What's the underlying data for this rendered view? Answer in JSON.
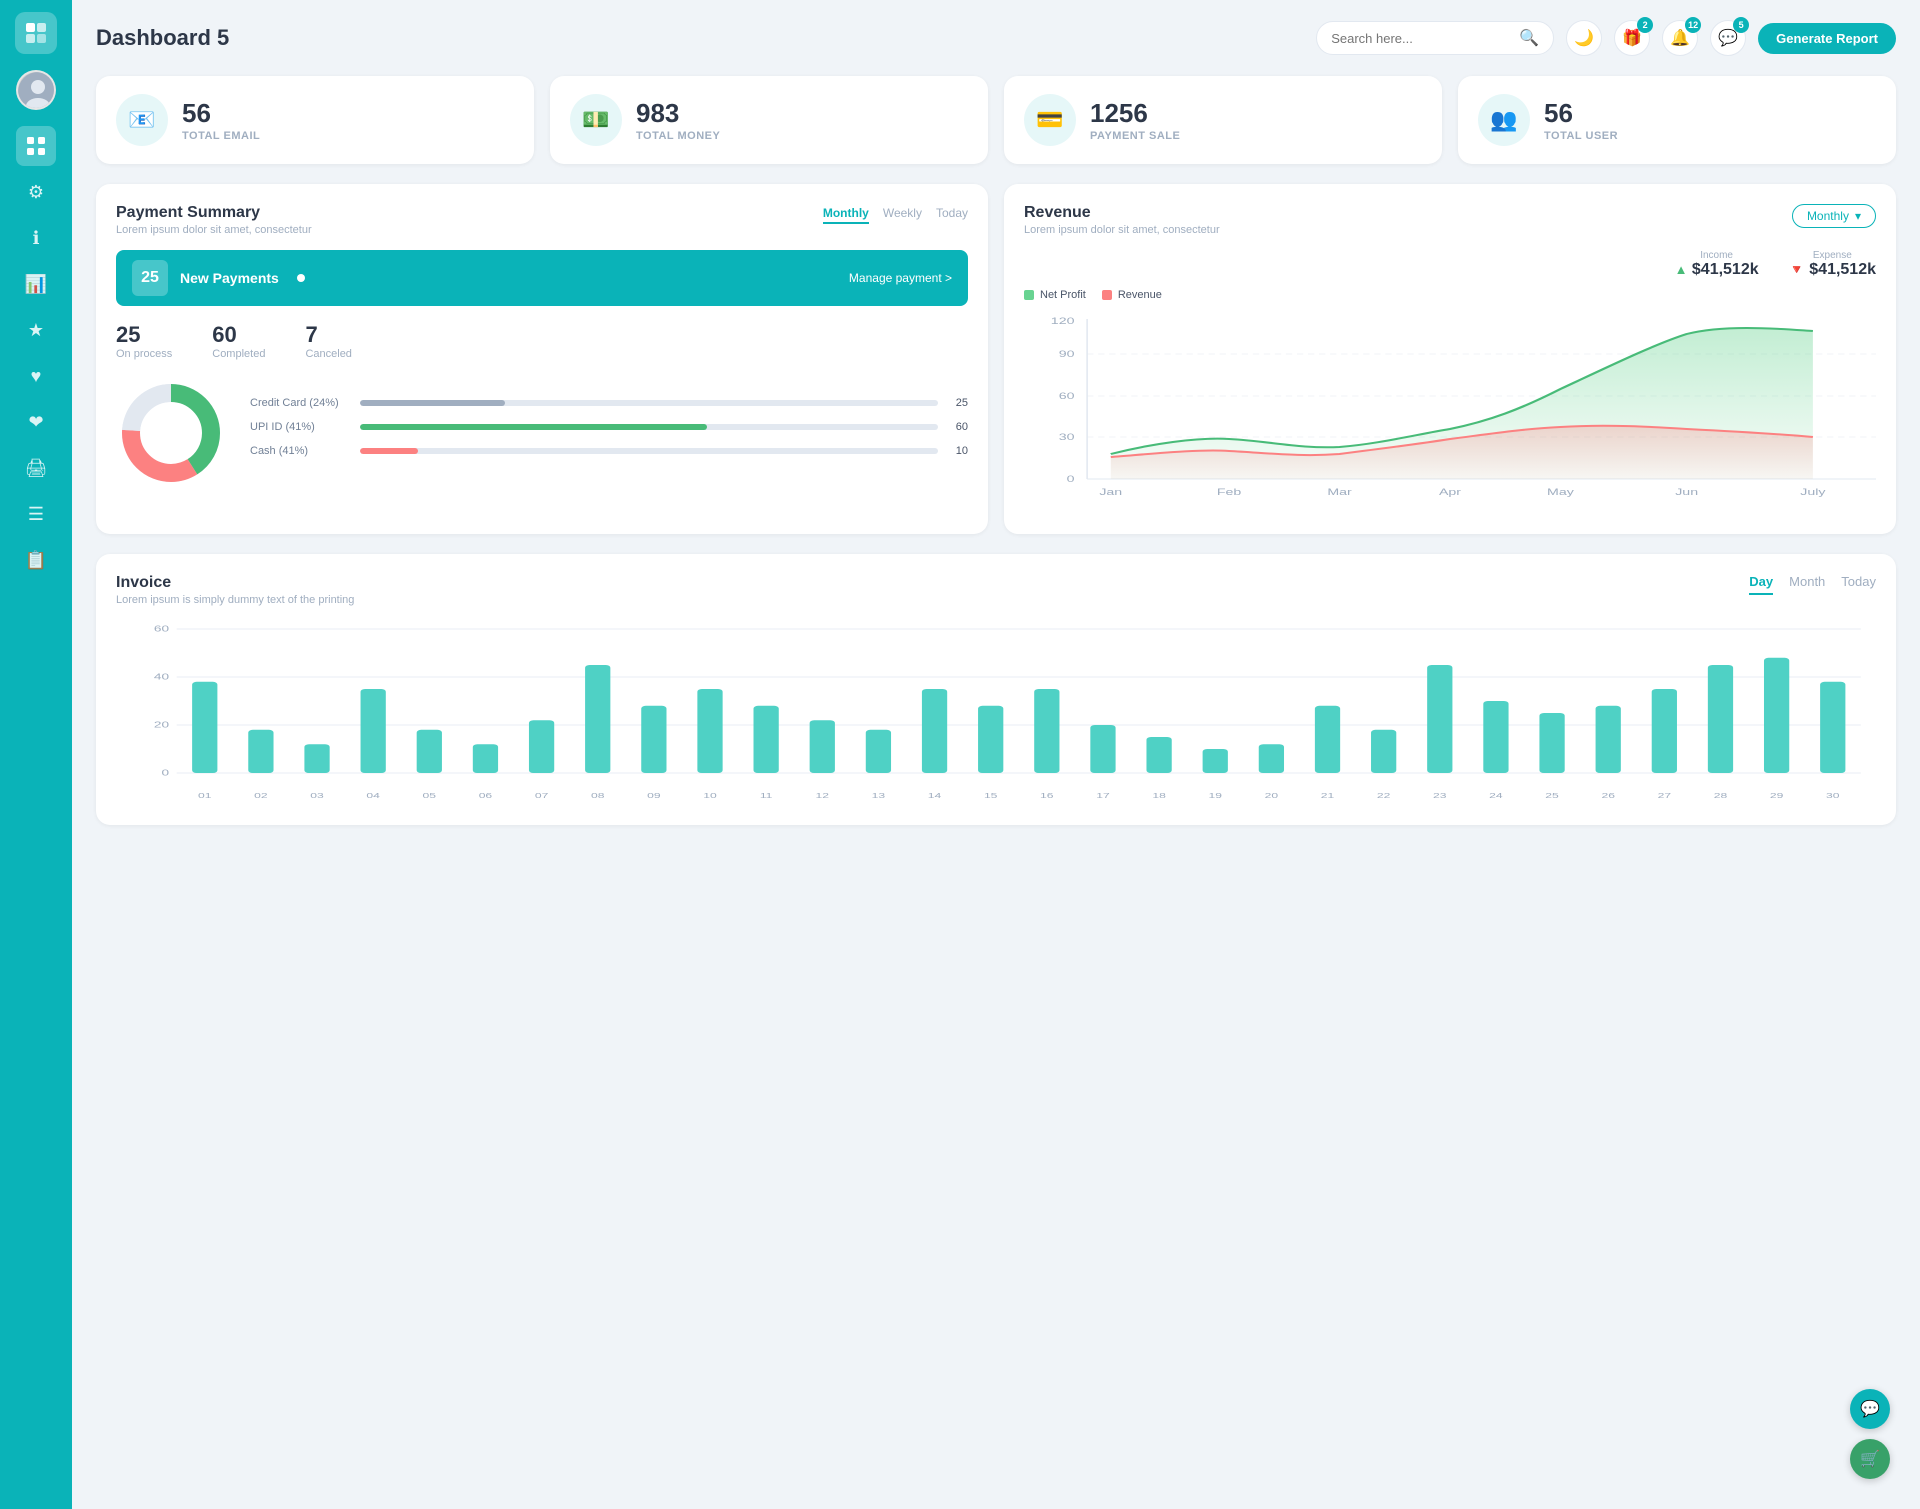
{
  "app": {
    "title": "Dashboard 5"
  },
  "header": {
    "search_placeholder": "Search here...",
    "generate_btn": "Generate Report",
    "badges": {
      "gift": "2",
      "bell": "12",
      "chat": "5"
    }
  },
  "stat_cards": [
    {
      "id": "email",
      "value": "56",
      "label": "TOTAL EMAIL"
    },
    {
      "id": "money",
      "value": "983",
      "label": "TOTAL MONEY"
    },
    {
      "id": "payment",
      "value": "1256",
      "label": "PAYMENT SALE"
    },
    {
      "id": "user",
      "value": "56",
      "label": "TOTAL USER"
    }
  ],
  "payment_summary": {
    "title": "Payment Summary",
    "subtitle": "Lorem ipsum dolor sit amet, consectetur",
    "tabs": [
      "Monthly",
      "Weekly",
      "Today"
    ],
    "active_tab": "Monthly",
    "new_payments": {
      "count": "25",
      "label": "New Payments",
      "manage_link": "Manage payment >"
    },
    "stats": [
      {
        "value": "25",
        "label": "On process"
      },
      {
        "value": "60",
        "label": "Completed"
      },
      {
        "value": "7",
        "label": "Canceled"
      }
    ],
    "payment_methods": [
      {
        "label": "Credit Card (24%)",
        "value": 25,
        "max": 100,
        "color": "#a0aec0",
        "display": "25"
      },
      {
        "label": "UPI ID (41%)",
        "value": 60,
        "max": 100,
        "color": "#48bb78",
        "display": "60"
      },
      {
        "label": "Cash (41%)",
        "value": 10,
        "max": 100,
        "color": "#fc8181",
        "display": "10"
      }
    ],
    "donut": {
      "segments": [
        {
          "pct": 24,
          "color": "#a0aec0"
        },
        {
          "pct": 41,
          "color": "#48bb78"
        },
        {
          "pct": 35,
          "color": "#fc8181"
        }
      ]
    }
  },
  "revenue": {
    "title": "Revenue",
    "subtitle": "Lorem ipsum dolor sit amet, consectetur",
    "dropdown_label": "Monthly",
    "income": {
      "label": "Income",
      "amount": "$41,512k"
    },
    "expense": {
      "label": "Expense",
      "amount": "$41,512k"
    },
    "legend": [
      {
        "label": "Net Profit",
        "color": "#68d391"
      },
      {
        "label": "Revenue",
        "color": "#fc8181"
      }
    ],
    "chart_months": [
      "Jan",
      "Feb",
      "Mar",
      "Apr",
      "May",
      "Jun",
      "July"
    ],
    "chart_labels": [
      "0",
      "30",
      "60",
      "90",
      "120"
    ]
  },
  "invoice": {
    "title": "Invoice",
    "subtitle": "Lorem ipsum is simply dummy text of the printing",
    "tabs": [
      "Day",
      "Month",
      "Today"
    ],
    "active_tab": "Day",
    "bar_labels": [
      "01",
      "02",
      "03",
      "04",
      "05",
      "06",
      "07",
      "08",
      "09",
      "10",
      "11",
      "12",
      "13",
      "14",
      "15",
      "16",
      "17",
      "18",
      "19",
      "20",
      "21",
      "22",
      "23",
      "24",
      "25",
      "26",
      "27",
      "28",
      "29",
      "30"
    ],
    "bar_values": [
      38,
      18,
      12,
      35,
      18,
      12,
      22,
      45,
      28,
      35,
      28,
      22,
      18,
      35,
      28,
      35,
      20,
      15,
      10,
      12,
      28,
      18,
      45,
      30,
      25,
      28,
      35,
      45,
      48,
      38
    ],
    "y_labels": [
      "0",
      "20",
      "40",
      "60"
    ]
  },
  "fab": [
    {
      "id": "support",
      "icon": "💬",
      "color": "#0ab3b8"
    },
    {
      "id": "cart",
      "icon": "🛒",
      "color": "#38a169"
    }
  ]
}
